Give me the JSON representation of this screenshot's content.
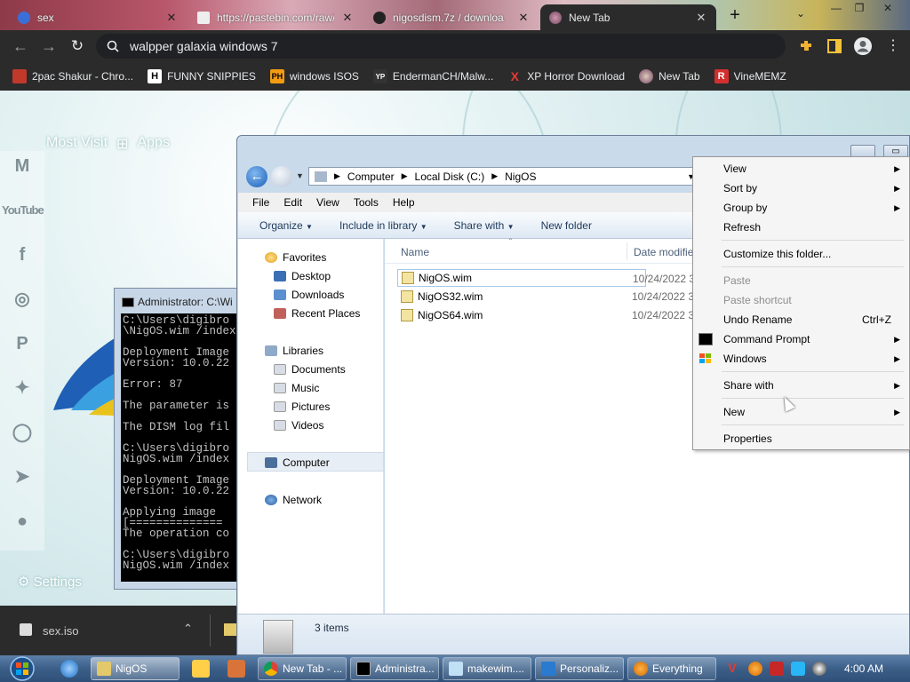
{
  "browser": {
    "tabs": [
      {
        "title": "sex",
        "active": false
      },
      {
        "title": "https://pastebin.com/raw/...",
        "active": false
      },
      {
        "title": "nigosdism.7z / downloa",
        "active": false
      },
      {
        "title": "New Tab",
        "active": true
      }
    ],
    "omnibox_value": "walpper galaxia windows 7",
    "bookmarks": [
      {
        "label": "2pac Shakur - Chro...",
        "icon": "tupac-icon",
        "color": "#c0392b"
      },
      {
        "label": "FUNNY SNIPPIES",
        "icon": "h-icon",
        "badge": "H",
        "color": "#ffffff"
      },
      {
        "label": "windows ISOS",
        "icon": "ph-icon",
        "badge": "PH",
        "color": "#f39c12"
      },
      {
        "label": "EndermanCH/Malw...",
        "icon": "yp-icon",
        "badge": "YP",
        "color": "#333333"
      },
      {
        "label": "XP Horror Download",
        "icon": "x-icon",
        "badge": "X",
        "color": "#e53935"
      },
      {
        "label": "New Tab",
        "icon": "newtab-icon",
        "color": "#9e6b9e"
      },
      {
        "label": "VineMEMZ",
        "icon": "r-icon",
        "badge": "R",
        "color": "#d32f2f"
      }
    ]
  },
  "newtab": {
    "most_visited": "Most Visit",
    "apps": "Apps",
    "settings": "Settings",
    "social": [
      "gmail-icon",
      "youtube-icon",
      "facebook-icon",
      "instagram-icon",
      "pinterest-icon",
      "twitter-icon",
      "whatsapp-icon",
      "telegram-icon",
      "reddit-icon"
    ]
  },
  "cmd": {
    "title": "Administrator: C:\\Wi",
    "lines": [
      "C:\\Users\\digibro",
      "\\NigOS.wim /index",
      "",
      "Deployment Image",
      "Version: 10.0.22",
      "",
      "Error: 87",
      "",
      "The parameter is",
      "",
      "The DISM log fil",
      "",
      "C:\\Users\\digibro",
      "NigOS.wim /index",
      "",
      "Deployment Image",
      "Version: 10.0.22",
      "",
      "Applying image",
      "[==============",
      "The operation co",
      "",
      "C:\\Users\\digibro",
      "NigOS.wim /index"
    ]
  },
  "shelf": {
    "file": "sex.iso"
  },
  "explorer": {
    "breadcrumb": [
      "Computer",
      "Local Disk (C:)",
      "NigOS"
    ],
    "menu": [
      "File",
      "Edit",
      "View",
      "Tools",
      "Help"
    ],
    "commands": [
      "Organize",
      "Include in library",
      "Share with",
      "New folder"
    ],
    "nav": {
      "favorites": "Favorites",
      "favorite_items": [
        "Desktop",
        "Downloads",
        "Recent Places"
      ],
      "libraries": "Libraries",
      "library_items": [
        "Documents",
        "Music",
        "Pictures",
        "Videos"
      ],
      "computer": "Computer",
      "network": "Network"
    },
    "columns": {
      "name": "Name",
      "date": "Date modifie"
    },
    "files": [
      {
        "name": "NigOS.wim",
        "date": "10/24/2022 3"
      },
      {
        "name": "NigOS32.wim",
        "date": "10/24/2022 3"
      },
      {
        "name": "NigOS64.wim",
        "date": "10/24/2022 3"
      }
    ],
    "status": "3 items"
  },
  "context_menu": {
    "items": [
      {
        "label": "View",
        "submenu": true
      },
      {
        "label": "Sort by",
        "submenu": true
      },
      {
        "label": "Group by",
        "submenu": true
      },
      {
        "label": "Refresh"
      },
      {
        "label": "Customize this folder..."
      },
      {
        "label": "Paste",
        "disabled": true
      },
      {
        "label": "Paste shortcut",
        "disabled": true
      },
      {
        "label": "Undo Rename",
        "shortcut": "Ctrl+Z"
      },
      {
        "label": "Command Prompt",
        "submenu": true,
        "icon": "cmd-icon"
      },
      {
        "label": "Windows",
        "submenu": true,
        "icon": "windows-icon"
      },
      {
        "label": "Share with",
        "submenu": true
      },
      {
        "label": "New",
        "submenu": true
      },
      {
        "label": "Properties"
      }
    ]
  },
  "taskbar": {
    "buttons": [
      {
        "label": "NigOS",
        "icon": "folder-icon"
      },
      {
        "label": "New Tab - ...",
        "icon": "chrome-icon"
      },
      {
        "label": "Administra...",
        "icon": "cmd-icon"
      },
      {
        "label": "makewim....",
        "icon": "notepad-icon"
      },
      {
        "label": "Personaliz...",
        "icon": "personalize-icon"
      },
      {
        "label": "Everything",
        "icon": "everything-icon"
      }
    ],
    "clock": "4:00 AM"
  }
}
